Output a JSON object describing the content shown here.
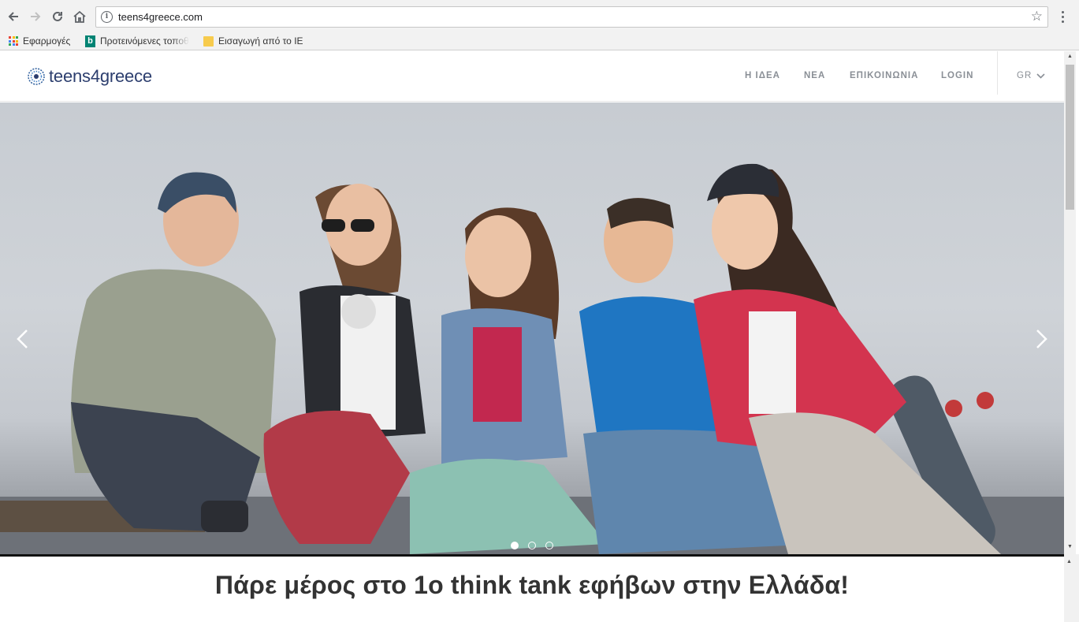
{
  "browser": {
    "url": "teens4greece.com",
    "icons": {
      "back": "arrow-left-icon",
      "forward": "arrow-right-icon",
      "reload": "reload-icon",
      "home": "home-icon",
      "info": "info-icon",
      "bookmark": "star-icon",
      "menu": "more-vert-icon"
    },
    "bookmarks": [
      {
        "label": "Εφαρμογές",
        "icon": "apps-grid-icon"
      },
      {
        "label": "Προτεινόμενες τοποθ",
        "icon": "bing-icon"
      },
      {
        "label": "Εισαγωγή από το IE",
        "icon": "folder-icon"
      }
    ]
  },
  "site": {
    "logo_text": "teens4greece",
    "nav": [
      "Η ΙΔΕΑ",
      "ΝΕΑ",
      "ΕΠΙΚΟΙΝΩΝΙΑ",
      "LOGIN"
    ],
    "language": "GR",
    "brand_color": "#2c3e6e"
  },
  "hero": {
    "slide_count": 3,
    "active_slide": 1,
    "icons": {
      "prev": "chevron-left-icon",
      "next": "chevron-right-icon"
    }
  },
  "intro": {
    "headline": "Πάρε μέρος στο 1ο think tank εφήβων στην Ελλάδα!"
  }
}
